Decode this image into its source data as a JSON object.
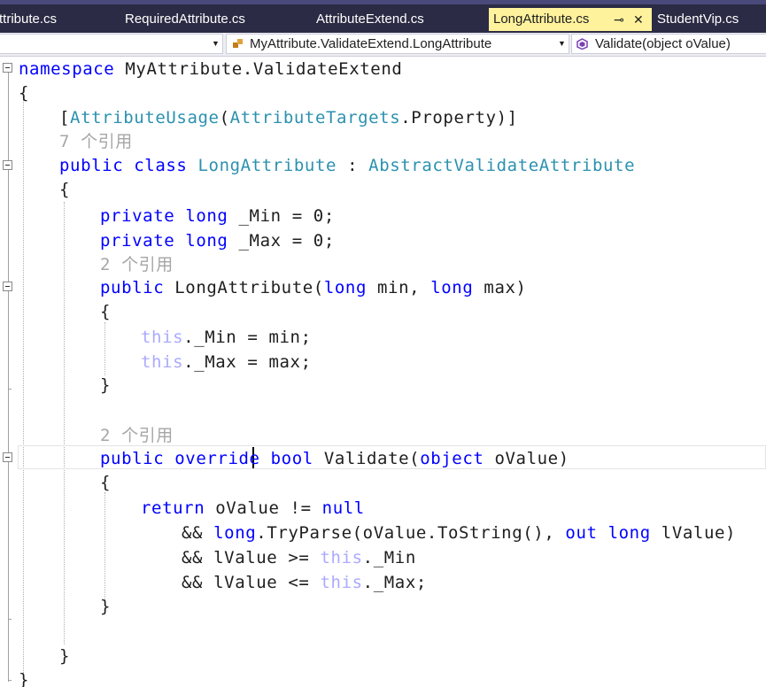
{
  "tabs": [
    {
      "label": "ttribute.cs"
    },
    {
      "label": "RequiredAttribute.cs"
    },
    {
      "label": "AttributeExtend.cs"
    },
    {
      "label": "LongAttribute.cs",
      "active": true
    },
    {
      "label": "StudentVip.cs"
    }
  ],
  "tab_icons": {
    "pin": "pin-icon",
    "close": "close-icon"
  },
  "nav": {
    "project": "",
    "type_name": "MyAttribute.ValidateExtend.LongAttribute",
    "member_name": "Validate(object oValue)"
  },
  "code_lens": {
    "refs_7": "7 个引用",
    "refs_2a": "2 个引用",
    "refs_2b": "2 个引用"
  },
  "code": {
    "l1": {
      "kw": "namespace",
      "rest": " MyAttribute.ValidateExtend"
    },
    "l2": "{",
    "l3": {
      "open": "[",
      "attr": "AttributeUsage",
      "paren": "(",
      "enum": "AttributeTargets",
      "rest": ".Property)]"
    },
    "l5": {
      "kw1": "public",
      "kw2": " class ",
      "name": "LongAttribute",
      "colon": " : ",
      "base": "AbstractValidateAttribute"
    },
    "l6": "{",
    "l7": {
      "kw1": "private",
      "kw2": " long",
      "rest": " _Min = 0;"
    },
    "l8": {
      "kw1": "private",
      "kw2": " long",
      "rest": " _Max = 0;"
    },
    "l10": {
      "kw": "public",
      "name": " LongAttribute(",
      "kw2": "long",
      "mid": " min, ",
      "kw3": "long",
      "rest": " max)"
    },
    "l11": "{",
    "l12": {
      "th": "this",
      "rest": "._Min = min;"
    },
    "l13": {
      "th": "this",
      "rest": "._Max = max;"
    },
    "l14": "}",
    "l17": {
      "kw1": "public",
      "kw2": " override",
      "kw3": " bool",
      "name": " Validate(",
      "kw4": "object",
      "rest": " oValue)"
    },
    "l18": "{",
    "l19": {
      "kw": "return",
      "mid": " oValue != ",
      "kw2": "null"
    },
    "l20": {
      "pre": "&& ",
      "kw": "long",
      "mid": ".TryParse(oValue.ToString(), ",
      "kw2": "out",
      "kw3": " long",
      "rest": " lValue)"
    },
    "l21": {
      "pre": "&& lValue >= ",
      "th": "this",
      "rest": "._Min"
    },
    "l22": {
      "pre": "&& lValue <= ",
      "th": "this",
      "rest": "._Max;"
    },
    "l23": "}",
    "l26": "}",
    "l27": "}"
  },
  "colors": {
    "keyword": "#0000ff",
    "type": "#2b91af",
    "this": "#aaaaff",
    "codelens": "#a6a6a6",
    "tab_active": "#fff29d",
    "tab_strip": "#2b2b45"
  }
}
